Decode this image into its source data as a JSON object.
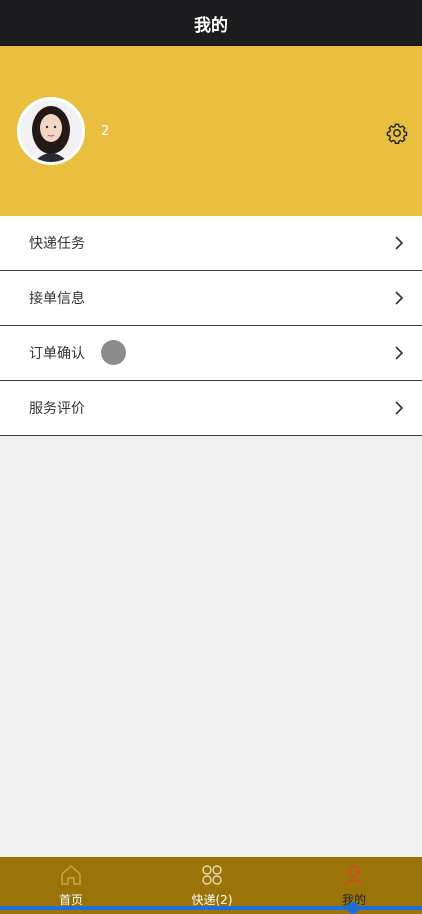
{
  "header": {
    "title": "我的"
  },
  "profile": {
    "username": "2"
  },
  "menu": {
    "items": [
      {
        "label": "快递任务"
      },
      {
        "label": "接单信息"
      },
      {
        "label": "订单确认"
      },
      {
        "label": "服务评价"
      }
    ]
  },
  "tabbar": {
    "tabs": [
      {
        "label": "首页",
        "icon": "home-icon"
      },
      {
        "label": "快递(2)",
        "icon": "grid-icon"
      },
      {
        "label": "我的",
        "icon": "user-icon"
      }
    ]
  },
  "colors": {
    "topbar": "#1c1c1e",
    "profile_bg": "#e8bf3f",
    "tabbar_bg": "#9b7409",
    "active_tab": "#d44a17"
  }
}
